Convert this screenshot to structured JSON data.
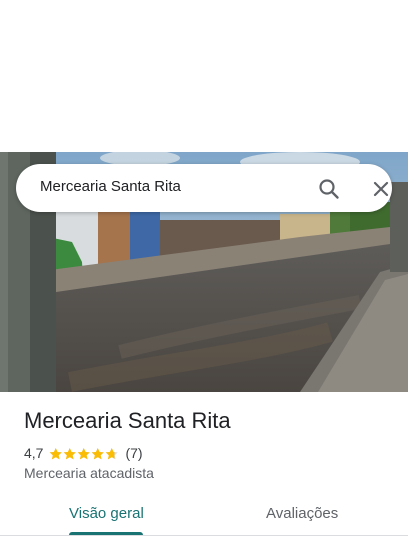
{
  "search": {
    "query": "Mercearia Santa Rita",
    "search_icon": "search-icon",
    "close_icon": "close-icon"
  },
  "hero": {
    "photo": "street-photo"
  },
  "place": {
    "name": "Mercearia Santa Rita",
    "rating": "4,7",
    "rating_value": 4.7,
    "stars_max": 5,
    "review_count": "(7)",
    "category": "Mercearia atacadista"
  },
  "tabs": [
    {
      "label": "Visão geral",
      "active": true
    },
    {
      "label": "Avaliações",
      "active": false
    }
  ],
  "colors": {
    "accent": "#1a7373",
    "star": "#fbbc04"
  }
}
